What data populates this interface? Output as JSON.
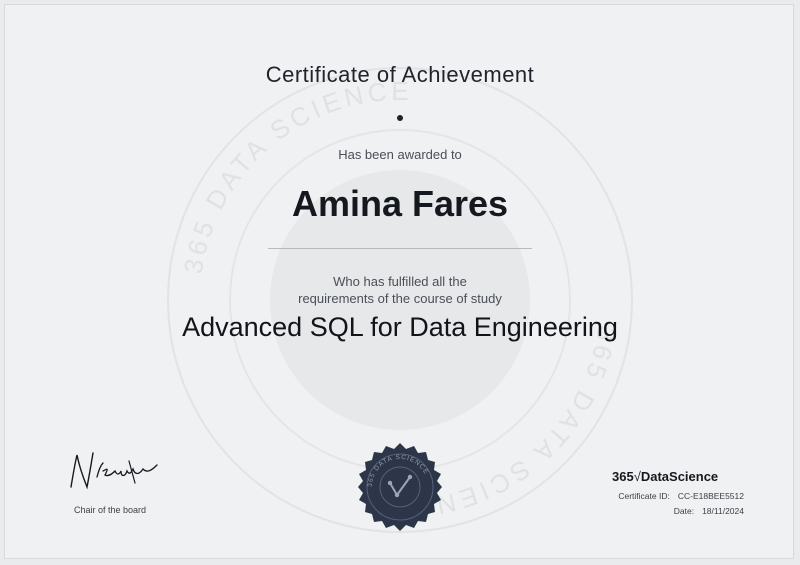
{
  "certificate": {
    "title": "Certificate of Achievement",
    "awarded_label": "Has been awarded to",
    "recipient_name": "Amina Fares",
    "fulfilled_line1": "Who has fulfilled all the",
    "fulfilled_line2": "requirements of the course of study",
    "course_name": "Advanced SQL for Data Engineering"
  },
  "signature": {
    "signature_text": "N.Krastev",
    "caption": "Chair of the board"
  },
  "seal": {
    "ring_text": "365 DATA SCIENCE"
  },
  "watermark": {
    "ring_text": "365 DATA SCIENCE"
  },
  "brand": {
    "prefix": "365",
    "symbol": "√",
    "name": "DataScience"
  },
  "meta": {
    "certificate_id_label": "Certificate ID:",
    "certificate_id_value": "CC-E18BEE5512",
    "date_label": "Date:",
    "date_value": "18/11/2024"
  },
  "colors": {
    "background": "#e9ebec",
    "seal": "#2c3648",
    "text": "#1b1f27"
  }
}
